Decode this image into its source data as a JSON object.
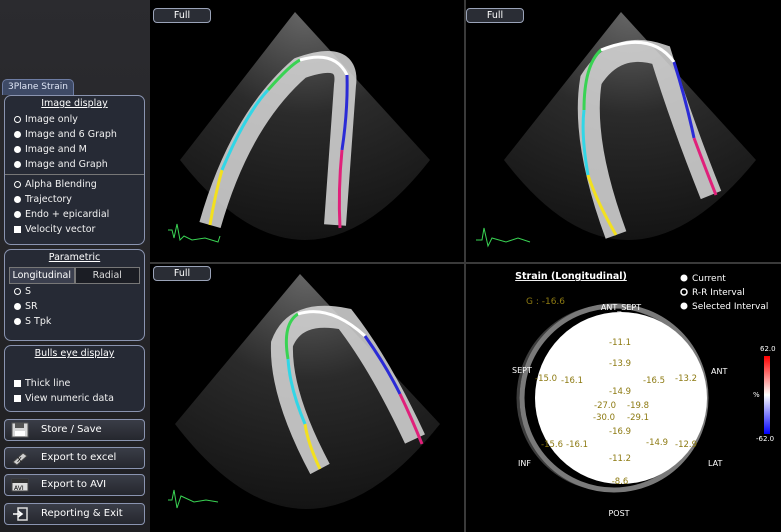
{
  "tab_label": "3Plane Strain",
  "image_display": {
    "title": "Image display",
    "options": [
      "Image only",
      "Image and 6 Graph",
      "Image and M",
      "Image and Graph"
    ],
    "overlay_options": [
      "Alpha Blending",
      "Trajectory",
      "Endo + epicardial"
    ],
    "velocity_vector": "Velocity vector"
  },
  "parametric": {
    "title": "Parametric",
    "tabs": [
      "Longitudinal",
      "Radial"
    ],
    "options": [
      "S",
      "SR",
      "S Tpk"
    ]
  },
  "bulls_eye_display": {
    "title": "Bulls eye display",
    "checkboxes": [
      "Thick line",
      "View numeric data"
    ]
  },
  "buttons": {
    "store_save": "Store / Save",
    "export_excel": "Export to excel",
    "export_avi": "Export to AVI",
    "reporting_exit": "Reporting & Exit",
    "avi_icon_text": "AVI"
  },
  "full_label": "Full",
  "bullseye": {
    "title": "Strain (Longitudinal)",
    "global": "G : -16.6",
    "legend": [
      "Current",
      "R-R Interval",
      "Selected Interval"
    ],
    "labels": {
      "top": "ANT_SEPT",
      "left": "SEPT",
      "right": "ANT",
      "bottom_left": "INF",
      "bottom_right": "LAT",
      "bottom": "POST"
    },
    "values": [
      "-11.1",
      "-13.9",
      "-15.0",
      "-16.1",
      "-16.5",
      "-13.2",
      "-14.9",
      "-27.0",
      "-19.8",
      "-30.0",
      "-29.1",
      "-16.9",
      "-15.6",
      "-16.1",
      "-14.9",
      "-12.9",
      "-11.2",
      "-8.6"
    ],
    "scale_max": "62.0",
    "scale_min": "-62.0",
    "scale_unit": "%"
  },
  "colors": {
    "panel_bg": "#262a35",
    "segment_green": "#39d353",
    "segment_cyan": "#32d6e6",
    "segment_yellow": "#f2e01f",
    "segment_blue": "#2b2bd6",
    "segment_magenta": "#e0207a",
    "value_text": "#8d7a12"
  }
}
